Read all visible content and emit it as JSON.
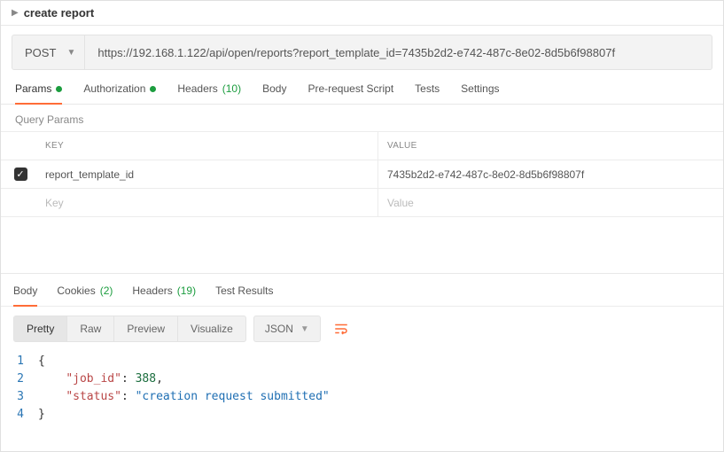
{
  "header": {
    "title": "create report"
  },
  "request": {
    "method": "POST",
    "url": "https://192.168.1.122/api/open/reports?report_template_id=7435b2d2-e742-487c-8e02-8d5b6f98807f"
  },
  "req_tabs": {
    "params": "Params",
    "auth": "Authorization",
    "headers": "Headers",
    "headers_count": "(10)",
    "body": "Body",
    "prereq": "Pre-request Script",
    "tests": "Tests",
    "settings": "Settings"
  },
  "query_params": {
    "section_label": "Query Params",
    "header_key": "Key",
    "header_value": "Value",
    "rows": [
      {
        "checked": true,
        "key": "report_template_id",
        "value": "7435b2d2-e742-487c-8e02-8d5b6f98807f"
      }
    ],
    "placeholder_key": "Key",
    "placeholder_value": "Value"
  },
  "resp_tabs": {
    "body": "Body",
    "cookies": "Cookies",
    "cookies_count": "(2)",
    "headers": "Headers",
    "headers_count": "(19)",
    "test_results": "Test Results"
  },
  "view_toolbar": {
    "pretty": "Pretty",
    "raw": "Raw",
    "preview": "Preview",
    "visualize": "Visualize",
    "format": "JSON"
  },
  "response_body": {
    "lines": [
      {
        "n": "1",
        "tokens": [
          {
            "t": "{",
            "c": ""
          }
        ]
      },
      {
        "n": "2",
        "tokens": [
          {
            "t": "    ",
            "c": ""
          },
          {
            "t": "\"job_id\"",
            "c": "k"
          },
          {
            "t": ": ",
            "c": ""
          },
          {
            "t": "388",
            "c": "n"
          },
          {
            "t": ",",
            "c": ""
          }
        ]
      },
      {
        "n": "3",
        "tokens": [
          {
            "t": "    ",
            "c": ""
          },
          {
            "t": "\"status\"",
            "c": "k"
          },
          {
            "t": ": ",
            "c": ""
          },
          {
            "t": "\"creation request submitted\"",
            "c": "s"
          }
        ]
      },
      {
        "n": "4",
        "tokens": [
          {
            "t": "}",
            "c": ""
          }
        ]
      }
    ]
  }
}
